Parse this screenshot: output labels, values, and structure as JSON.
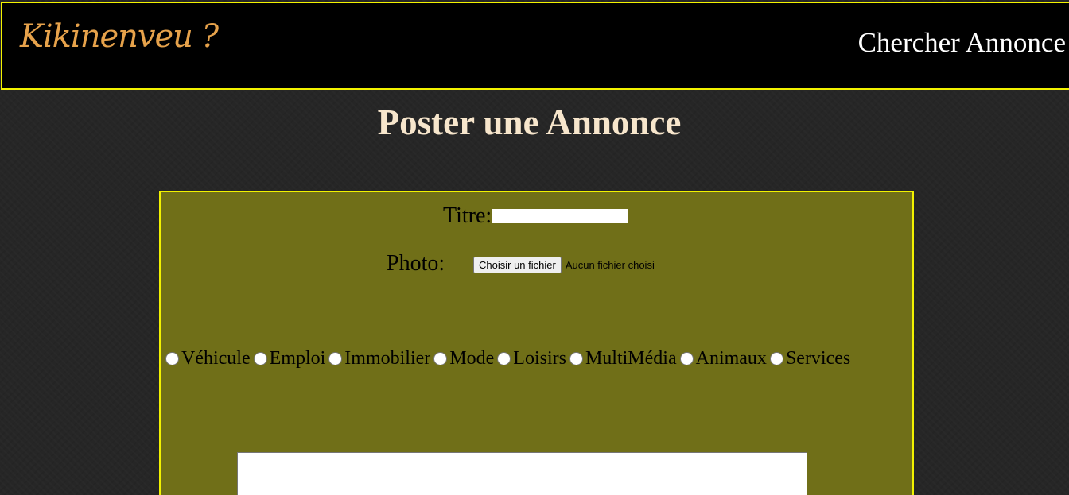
{
  "header": {
    "logo_text": "Kikinenveu ?",
    "search_link": "Chercher Annonce"
  },
  "main": {
    "title": "Poster une Annonce"
  },
  "form": {
    "title_label": "Titre:",
    "title_value": "",
    "photo_label": "Photo:",
    "file_button": "Choisir un fichier",
    "file_status": "Aucun fichier choisi",
    "categories": [
      "Véhicule",
      "Emploi",
      "Immobilier",
      "Mode",
      "Loisirs",
      "MultiMédia",
      "Animaux",
      "Services"
    ],
    "description_value": ""
  },
  "colors": {
    "header_bg": "#000000",
    "border_accent": "#f2f200",
    "logo": "#e6a24b",
    "title": "#f7e6cc",
    "panel_bg": "#706f18",
    "page_bg": "#262626"
  }
}
